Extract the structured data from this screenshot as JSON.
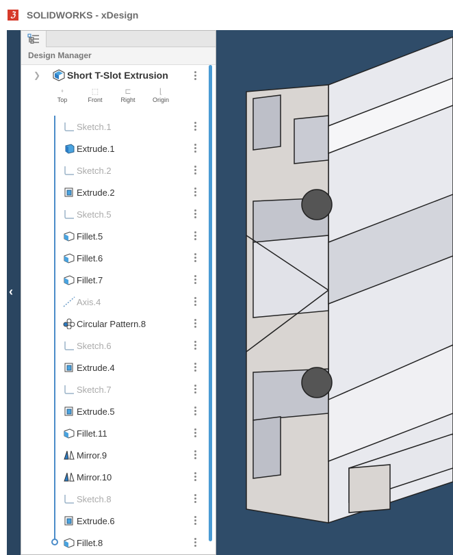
{
  "app": {
    "title": "SOLIDWORKS - xDesign",
    "logo": "3DS"
  },
  "panel": {
    "title": "Design Manager",
    "root": "Short T-Slot Extrusion",
    "planes": [
      "Top",
      "Front",
      "Right",
      "Origin"
    ],
    "items": [
      {
        "label": "Sketch.1",
        "icon": "sketch-icon",
        "dim": true
      },
      {
        "label": "Extrude.1",
        "icon": "extrude-icon",
        "dim": false
      },
      {
        "label": "Sketch.2",
        "icon": "sketch-icon",
        "dim": true
      },
      {
        "label": "Extrude.2",
        "icon": "extrude-cut-icon",
        "dim": false
      },
      {
        "label": "Sketch.5",
        "icon": "sketch-icon",
        "dim": true
      },
      {
        "label": "Fillet.5",
        "icon": "fillet-icon",
        "dim": false
      },
      {
        "label": "Fillet.6",
        "icon": "fillet-icon",
        "dim": false
      },
      {
        "label": "Fillet.7",
        "icon": "fillet-icon",
        "dim": false
      },
      {
        "label": "Axis.4",
        "icon": "axis-icon",
        "dim": true
      },
      {
        "label": "Circular Pattern.8",
        "icon": "circular-pattern-icon",
        "dim": false
      },
      {
        "label": "Sketch.6",
        "icon": "sketch-icon",
        "dim": true
      },
      {
        "label": "Extrude.4",
        "icon": "extrude-cut-icon",
        "dim": false
      },
      {
        "label": "Sketch.7",
        "icon": "sketch-icon",
        "dim": true
      },
      {
        "label": "Extrude.5",
        "icon": "extrude-cut-icon",
        "dim": false
      },
      {
        "label": "Fillet.11",
        "icon": "fillet-icon",
        "dim": false
      },
      {
        "label": "Mirror.9",
        "icon": "mirror-icon",
        "dim": false
      },
      {
        "label": "Mirror.10",
        "icon": "mirror-icon",
        "dim": false
      },
      {
        "label": "Sketch.8",
        "icon": "sketch-icon",
        "dim": true
      },
      {
        "label": "Extrude.6",
        "icon": "extrude-cut-icon",
        "dim": false
      },
      {
        "label": "Fillet.8",
        "icon": "fillet-icon",
        "dim": false
      }
    ]
  },
  "colors": {
    "viewport": "#2f4c69",
    "accent": "#4a9bd4",
    "logo": "#d63a2a"
  }
}
